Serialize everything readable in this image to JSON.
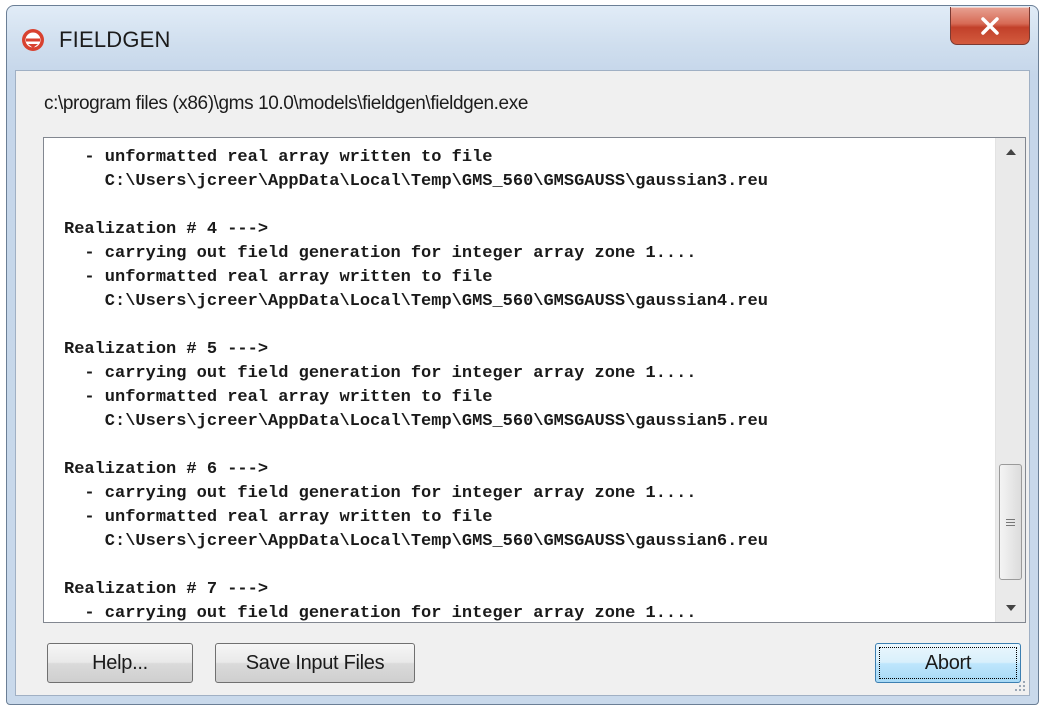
{
  "window": {
    "title": "FIELDGEN"
  },
  "path": "c:\\program files (x86)\\gms 10.0\\models\\fieldgen\\fieldgen.exe",
  "output": {
    "lines": [
      "  - unformatted real array written to file",
      "    C:\\Users\\jcreer\\AppData\\Local\\Temp\\GMS_560\\GMSGAUSS\\gaussian3.reu",
      "",
      "Realization # 4 --->",
      "  - carrying out field generation for integer array zone 1....",
      "  - unformatted real array written to file",
      "    C:\\Users\\jcreer\\AppData\\Local\\Temp\\GMS_560\\GMSGAUSS\\gaussian4.reu",
      "",
      "Realization # 5 --->",
      "  - carrying out field generation for integer array zone 1....",
      "  - unformatted real array written to file",
      "    C:\\Users\\jcreer\\AppData\\Local\\Temp\\GMS_560\\GMSGAUSS\\gaussian5.reu",
      "",
      "Realization # 6 --->",
      "  - carrying out field generation for integer array zone 1....",
      "  - unformatted real array written to file",
      "    C:\\Users\\jcreer\\AppData\\Local\\Temp\\GMS_560\\GMSGAUSS\\gaussian6.reu",
      "",
      "Realization # 7 --->",
      "  - carrying out field generation for integer array zone 1...."
    ]
  },
  "buttons": {
    "help": "Help...",
    "save": "Save Input Files",
    "abort": "Abort"
  },
  "icons": {
    "app": "fieldgen-app-icon",
    "close": "close-icon"
  },
  "colors": {
    "close": "#c2402a",
    "app_icon": "#d8412f",
    "focus": "#3c7fb1"
  }
}
